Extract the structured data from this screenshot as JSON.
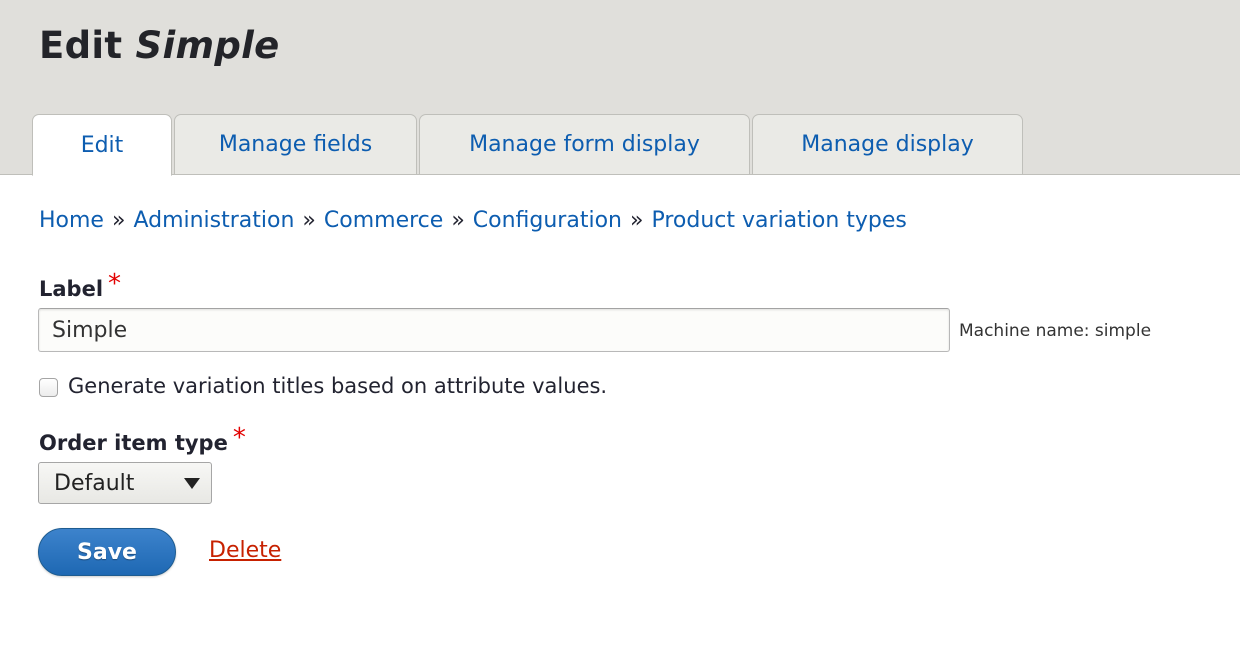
{
  "header": {
    "title_prefix": "Edit",
    "title_entity": "Simple"
  },
  "tabs": [
    {
      "label": "Edit",
      "active": true
    },
    {
      "label": "Manage fields",
      "active": false
    },
    {
      "label": "Manage form display",
      "active": false
    },
    {
      "label": "Manage display",
      "active": false
    }
  ],
  "breadcrumb": {
    "items": [
      "Home",
      "Administration",
      "Commerce",
      "Configuration",
      "Product variation types"
    ],
    "separator": "»"
  },
  "form": {
    "label_field": {
      "label": "Label",
      "required_marker": "*",
      "value": "Simple",
      "machine_name": "Machine name: simple"
    },
    "generate_titles": {
      "label": "Generate variation titles based on attribute values.",
      "checked": false
    },
    "order_item_type": {
      "label": "Order item type",
      "required_marker": "*",
      "selected": "Default"
    },
    "actions": {
      "save_label": "Save",
      "delete_label": "Delete"
    }
  },
  "colors": {
    "link": "#0d5db0",
    "header_bg": "#e0dfdb",
    "required": "#e30000",
    "primary_button": "#2a72bd",
    "danger_link": "#c72100"
  }
}
